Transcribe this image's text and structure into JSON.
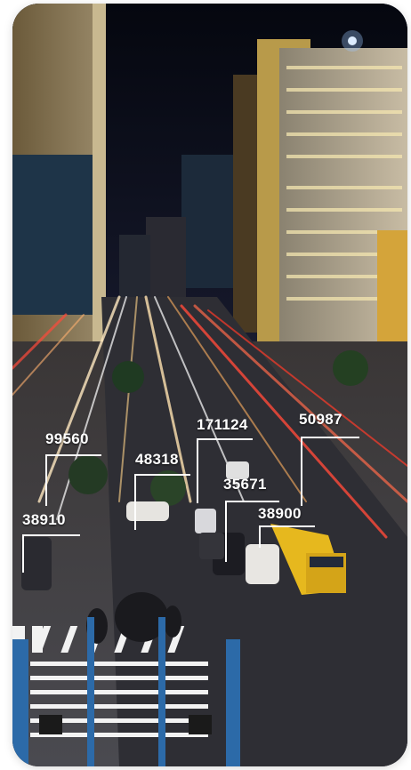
{
  "annotations": [
    {
      "value": "99560"
    },
    {
      "value": "48318"
    },
    {
      "value": "171124"
    },
    {
      "value": "50987"
    },
    {
      "value": "35671"
    },
    {
      "value": "38900"
    },
    {
      "value": "38910"
    }
  ]
}
